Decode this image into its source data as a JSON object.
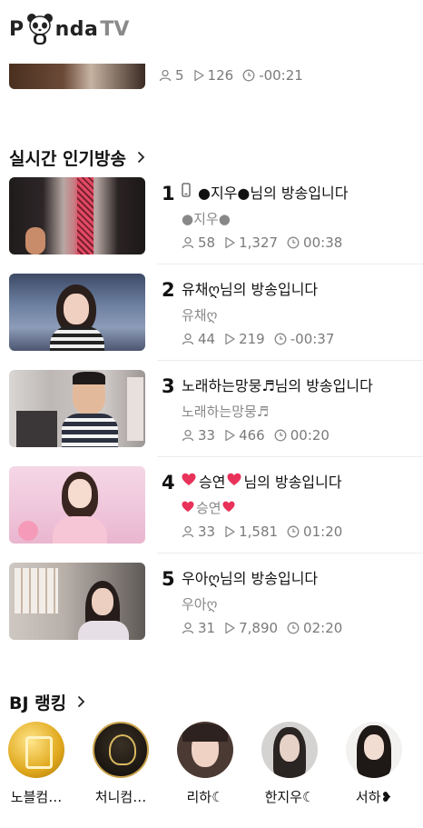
{
  "logo": {
    "prefix": "P",
    "suffix": "nda",
    "tv": "TV"
  },
  "top_item": {
    "viewers": "5",
    "plays": "126",
    "time": "-00:21"
  },
  "popular": {
    "title": "실시간 인기방송",
    "items": [
      {
        "rank": "1",
        "title": "●지우●님의 방송입니다",
        "nick": "●지우●",
        "viewers": "58",
        "plays": "1,327",
        "time": "00:38"
      },
      {
        "rank": "2",
        "title": "유채ღ님의 방송입니다",
        "nick": "유채ღ",
        "viewers": "44",
        "plays": "219",
        "time": "-00:37"
      },
      {
        "rank": "3",
        "title": "노래하는망뭉♬님의 방송입니다",
        "nick": "노래하는망뭉♬",
        "viewers": "33",
        "plays": "466",
        "time": "00:20"
      },
      {
        "rank": "4",
        "title_a": "승연",
        "title_b": "님의 방송입니다",
        "nick": "승연",
        "viewers": "33",
        "plays": "1,581",
        "time": "01:20"
      },
      {
        "rank": "5",
        "title": "우아ღ님의 방송입니다",
        "nick": "우아ღ",
        "viewers": "31",
        "plays": "7,890",
        "time": "02:20"
      }
    ]
  },
  "bj_ranking": {
    "title": "BJ 랭킹",
    "items": [
      {
        "name": "노블컴…"
      },
      {
        "name": "처니컴…"
      },
      {
        "name": "리하☾"
      },
      {
        "name": "한지우☾"
      },
      {
        "name": "서하❥"
      }
    ]
  },
  "colors": {
    "heart": "#e8325a",
    "meta": "#7a7a7a",
    "text": "#111111"
  }
}
